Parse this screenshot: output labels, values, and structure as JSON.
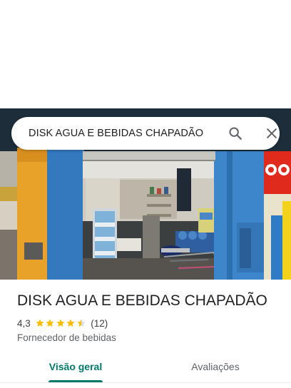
{
  "search": {
    "query": "DISK AGUA E BEBIDAS CHAPADÃO"
  },
  "place": {
    "name": "DISK AGUA E BEBIDAS CHAPADÃO",
    "rating": "4,3",
    "stars": 4.3,
    "review_count": "(12)",
    "category": "Fornecedor de bebidas"
  },
  "tabs": [
    {
      "label": "Visão geral",
      "selected": true
    },
    {
      "label": "Avaliações",
      "selected": false
    }
  ],
  "colors": {
    "accent": "#00796b",
    "star": "#fbbc04",
    "title": "#202124",
    "secondary": "#5f6368"
  },
  "icons": [
    "search-icon",
    "close-icon",
    "star-icon"
  ]
}
